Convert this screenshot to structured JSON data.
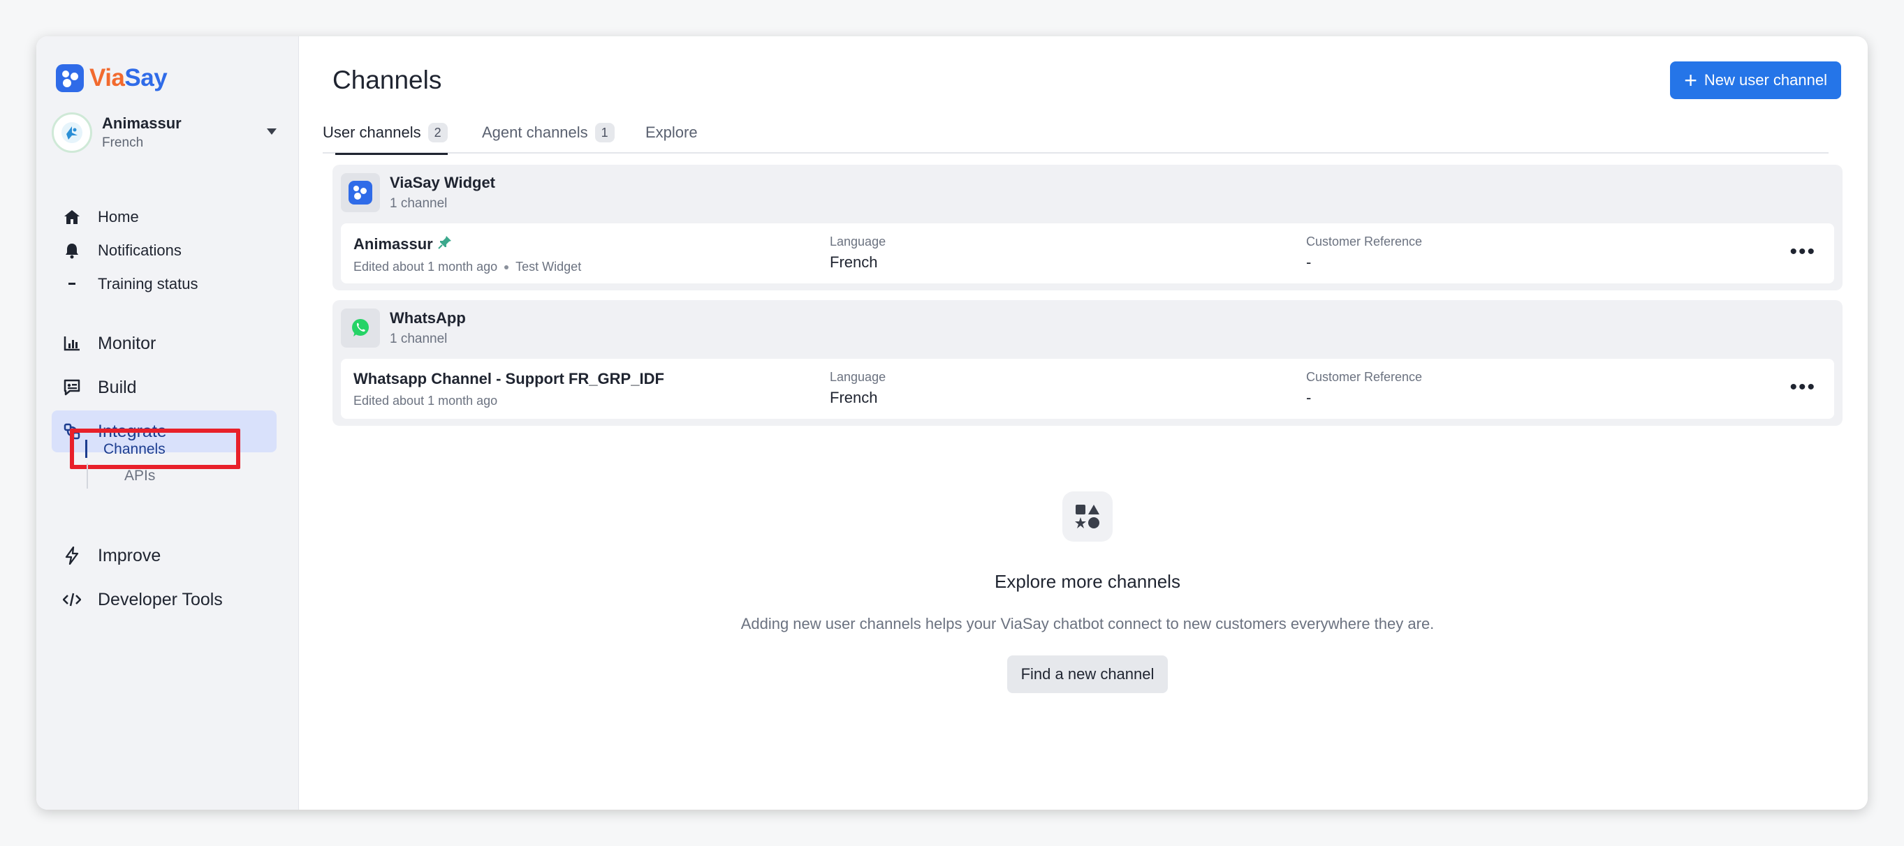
{
  "brand": {
    "name_part1": "Via",
    "name_part2": "Say",
    "accent_orange": "#f26a2e",
    "accent_blue": "#2f6be8"
  },
  "account": {
    "name": "Animassur",
    "language": "French"
  },
  "nav": {
    "small_items": [
      {
        "label": "Home",
        "icon": "home-icon"
      },
      {
        "label": "Notifications",
        "icon": "bell-icon"
      },
      {
        "label": "Training status",
        "icon": "minus-icon"
      }
    ],
    "big_items": [
      {
        "label": "Monitor",
        "icon": "chart-icon"
      },
      {
        "label": "Build",
        "icon": "chat-build-icon"
      },
      {
        "label": "Integrate",
        "icon": "integrate-icon"
      },
      {
        "label": "Improve",
        "icon": "bolt-icon"
      },
      {
        "label": "Developer Tools",
        "icon": "code-icon"
      }
    ],
    "sub_items": [
      {
        "label": "Channels"
      },
      {
        "label": "APIs"
      }
    ]
  },
  "page": {
    "title": "Channels",
    "new_button": "New user channel"
  },
  "tabs": [
    {
      "label": "User channels",
      "count": "2"
    },
    {
      "label": "Agent channels",
      "count": "1"
    },
    {
      "label": "Explore"
    }
  ],
  "groups": [
    {
      "name": "ViaSay Widget",
      "count": "1 channel",
      "row": {
        "name": "Animassur",
        "edited": "Edited about 1 month ago",
        "tag": "Test Widget",
        "language_label": "Language",
        "language": "French",
        "customer_ref_label": "Customer Reference",
        "customer_ref": "-"
      }
    },
    {
      "name": "WhatsApp",
      "count": "1 channel",
      "row": {
        "name": "Whatsapp Channel - Support FR_GRP_IDF",
        "edited": "Edited about 1 month ago",
        "language_label": "Language",
        "language": "French",
        "customer_ref_label": "Customer Reference",
        "customer_ref": "-"
      }
    }
  ],
  "explore": {
    "title": "Explore more channels",
    "description": "Adding new user channels helps your ViaSay chatbot connect to new customers everywhere they are.",
    "button": "Find a new channel"
  },
  "more_glyph": "•••"
}
